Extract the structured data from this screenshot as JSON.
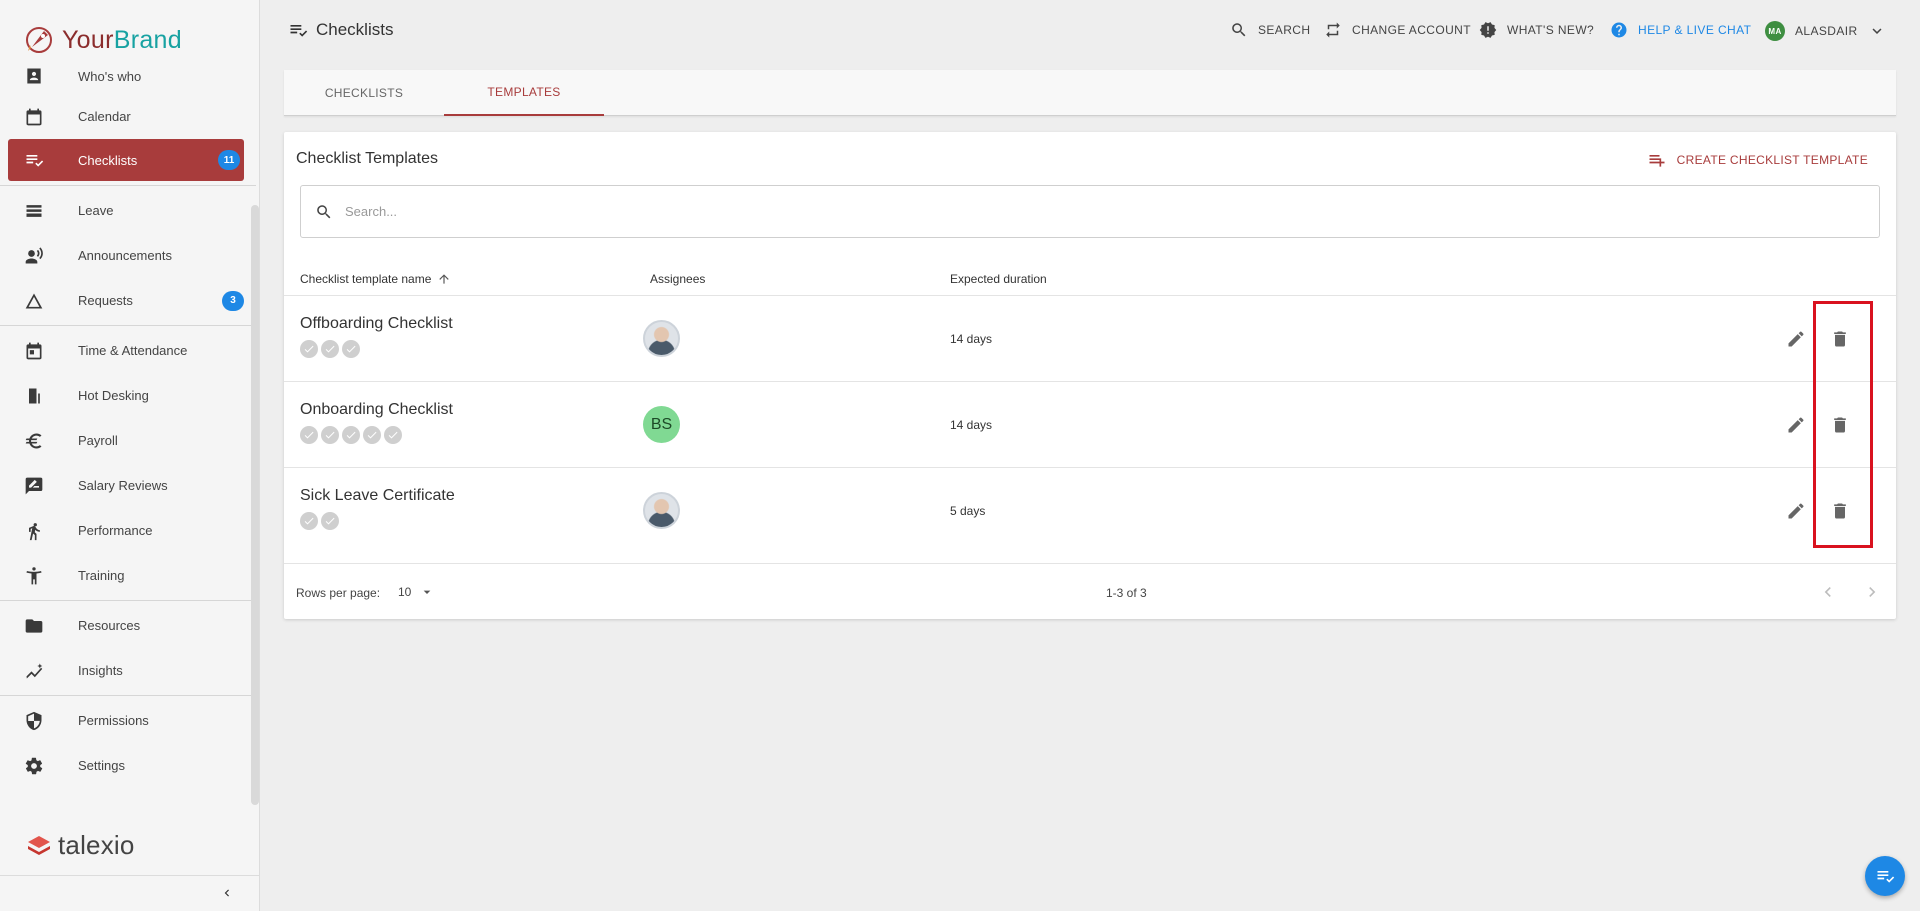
{
  "brand": {
    "part1": "Your",
    "part2": "Brand"
  },
  "sidebar": {
    "items": [
      {
        "label": "Who's who",
        "icon": "contact-card-icon"
      },
      {
        "label": "Calendar",
        "icon": "calendar-icon"
      },
      {
        "label": "Checklists",
        "icon": "checklist-icon",
        "badge": "11",
        "active": true
      },
      {
        "label": "Leave",
        "icon": "leave-icon"
      },
      {
        "label": "Announcements",
        "icon": "announcements-icon"
      },
      {
        "label": "Requests",
        "icon": "requests-icon",
        "badge": "3"
      },
      {
        "label": "Time & Attendance",
        "icon": "time-attendance-icon"
      },
      {
        "label": "Hot Desking",
        "icon": "hot-desking-icon"
      },
      {
        "label": "Payroll",
        "icon": "euro-icon"
      },
      {
        "label": "Salary Reviews",
        "icon": "salary-reviews-icon"
      },
      {
        "label": "Performance",
        "icon": "performance-icon"
      },
      {
        "label": "Training",
        "icon": "training-icon"
      },
      {
        "label": "Resources",
        "icon": "folder-icon"
      },
      {
        "label": "Insights",
        "icon": "insights-icon"
      },
      {
        "label": "Permissions",
        "icon": "shield-icon"
      },
      {
        "label": "Settings",
        "icon": "gear-icon"
      }
    ],
    "footer_logo": "talexio"
  },
  "header": {
    "title": "Checklists",
    "search": "SEARCH",
    "change_account": "CHANGE ACCOUNT",
    "whats_new": "WHAT'S NEW?",
    "help": "HELP & LIVE CHAT",
    "user_initials": "MA",
    "user_name": "ALASDAIR"
  },
  "tabs": [
    {
      "label": "CHECKLISTS",
      "active": false
    },
    {
      "label": "TEMPLATES",
      "active": true
    }
  ],
  "card": {
    "title": "Checklist Templates",
    "create_label": "CREATE CHECKLIST TEMPLATE",
    "search_placeholder": "Search...",
    "columns": [
      "Checklist template name",
      "Assignees",
      "Expected duration"
    ],
    "rows": [
      {
        "name": "Offboarding Checklist",
        "checks": 3,
        "assignee": "photo",
        "duration": "14 days"
      },
      {
        "name": "Onboarding Checklist",
        "checks": 5,
        "assignee": "BS",
        "duration": "14 days"
      },
      {
        "name": "Sick Leave Certificate",
        "checks": 2,
        "assignee": "photo",
        "duration": "5 days"
      }
    ],
    "rows_per_page_label": "Rows per page:",
    "rows_per_page": "10",
    "range": "1-3 of 3"
  },
  "colors": {
    "accent": "#a83c3c",
    "badge": "#1e88e5",
    "brand_teal": "#17a2a2",
    "highlight": "#d9121f"
  }
}
